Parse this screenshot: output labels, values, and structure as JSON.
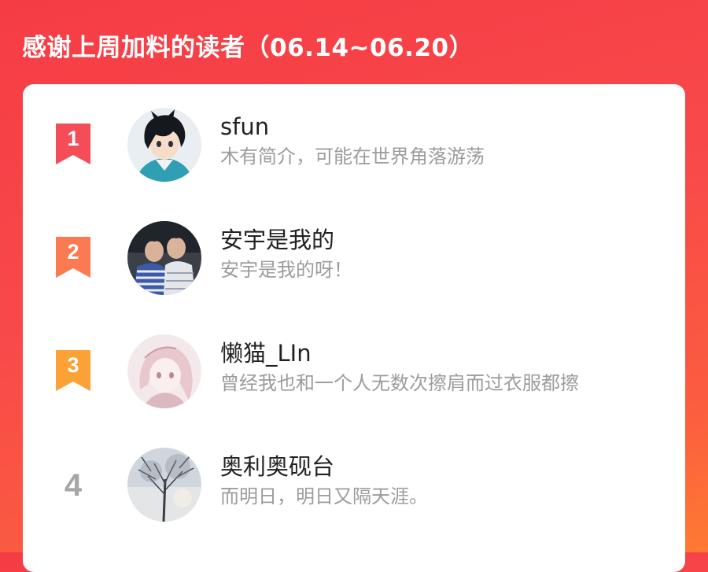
{
  "header": {
    "title": "感谢上周加料的读者（06.14~06.20）"
  },
  "readers": [
    {
      "rank": "1",
      "name": "sfun",
      "bio": "木有简介，可能在世界角落游荡",
      "badge_color": "#f54d58"
    },
    {
      "rank": "2",
      "name": "安宇是我的",
      "bio": "安宇是我的呀！",
      "badge_color": "#fb7a52"
    },
    {
      "rank": "3",
      "name": "懒猫_LIn",
      "bio": "曾经我也和一个人无数次擦肩而过衣服都擦",
      "badge_color": "#fca135"
    },
    {
      "rank": "4",
      "name": "奥利奥砚台",
      "bio": "而明日，明日又隔天涯。"
    }
  ],
  "colors": {
    "background_top": "#f53c45",
    "background_bottom": "#ff7a32",
    "card": "#ffffff",
    "name_text": "#222222",
    "bio_text": "#9c9c9c",
    "plain_rank": "#a6a6a6"
  }
}
